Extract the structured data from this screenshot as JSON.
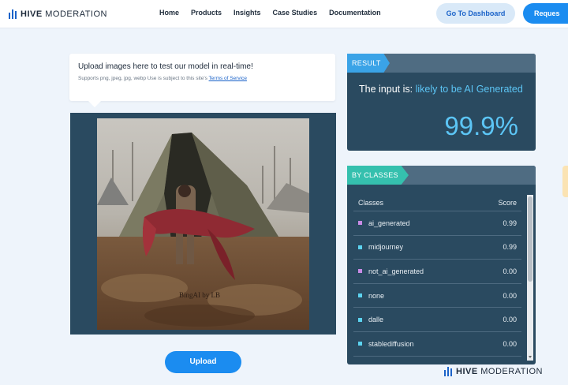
{
  "header": {
    "brand_bold": "HIVE",
    "brand_light": "MODERATION",
    "nav": [
      "Home",
      "Products",
      "Insights",
      "Case Studies",
      "Documentation"
    ],
    "dashboard_button": "Go To Dashboard",
    "request_button": "Reques"
  },
  "upload": {
    "title": "Upload images here to test our model in real-time!",
    "subtitle_prefix": "Supports png, jpeg, jpg, webp Use is subject to this site's",
    "terms_link": "Terms of Service",
    "image_watermark": "BingAI by LB",
    "upload_button": "Upload"
  },
  "result": {
    "tag": "RESULT",
    "prefix": "The input is:",
    "verdict": "likely to be AI Generated",
    "score": "99.9%"
  },
  "classes": {
    "tag": "BY CLASSES",
    "col_class": "Classes",
    "col_score": "Score",
    "rows": [
      {
        "name": "ai_generated",
        "score": "0.99",
        "color": "#c98be6"
      },
      {
        "name": "midjourney",
        "score": "0.99",
        "color": "#5cd3f0"
      },
      {
        "name": "not_ai_generated",
        "score": "0.00",
        "color": "#c98be6"
      },
      {
        "name": "none",
        "score": "0.00",
        "color": "#5cd3f0"
      },
      {
        "name": "dalle",
        "score": "0.00",
        "color": "#5cd3f0"
      },
      {
        "name": "stablediffusion",
        "score": "0.00",
        "color": "#5cd3f0"
      }
    ]
  },
  "footer": {
    "brand_bold": "HIVE",
    "brand_light": "MODERATION"
  },
  "colors": {
    "accent_blue": "#1b8cf0",
    "panel": "#2a4a60",
    "result_tag": "#3aa3e7",
    "classes_tag": "#35c0ae",
    "highlight": "#5cc5f5"
  }
}
